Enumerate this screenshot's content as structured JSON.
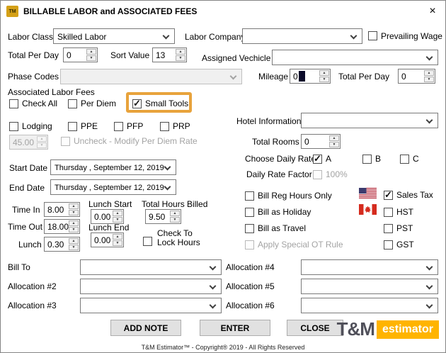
{
  "window": {
    "title": "BILLABLE LABOR and ASSOCIATED FEES",
    "icon": "TM",
    "close": "×"
  },
  "labor": {
    "labor_class_label": "Labor Class",
    "labor_class_value": "Skilled Labor",
    "labor_company_label": "Labor Company",
    "labor_company_value": "",
    "prevailing_wage_label": "Prevailing Wage",
    "prevailing_wage_checked": false,
    "total_per_day_label": "Total Per Day",
    "total_per_day_value": "0",
    "sort_value_label": "Sort Value",
    "sort_value_value": "13",
    "assigned_vehicle_label": "Assigned Vechicle",
    "assigned_vehicle_value": "",
    "phase_codes_label": "Phase Codes",
    "phase_codes_value": "",
    "phase_codes_enabled": false,
    "mileage_label": "Mileage",
    "mileage_value": "0",
    "total_per_day2_label": "Total Per Day",
    "total_per_day2_value": "0"
  },
  "fees": {
    "section_label": "Associated Labor Fees",
    "check_all_label": "Check All",
    "check_all_checked": false,
    "per_diem_label": "Per Diem",
    "per_diem_checked": false,
    "small_tools_label": "Small Tools",
    "small_tools_checked": true,
    "lodging_label": "Lodging",
    "lodging_checked": false,
    "ppe_label": "PPE",
    "pfp_label": "PFP",
    "prp_label": "PRP",
    "per_diem_rate_value": "45.00",
    "per_diem_rate_enabled": false,
    "uncheck_modify_label": "Uncheck - Modify Per Diem Rate"
  },
  "hotel": {
    "hotel_information_label": "Hotel Information",
    "hotel_information_value": "",
    "total_rooms_label": "Total Rooms",
    "total_rooms_value": "0",
    "choose_daily_rate_label": "Choose Daily Rate",
    "rate_a_label": "A",
    "rate_a_checked": true,
    "rate_b_label": "B",
    "rate_b_checked": false,
    "rate_c_label": "C",
    "rate_c_checked": false,
    "daily_rate_factor_label": "Daily Rate Factor",
    "daily_rate_factor_value": "100%"
  },
  "dates": {
    "start_date_label": "Start Date",
    "start_date_value": "Thursday , September 12, 2019",
    "end_date_label": "End Date",
    "end_date_value": "Thursday , September 12, 2019"
  },
  "hours": {
    "time_in_label": "Time In",
    "time_in_value": "8.00",
    "time_out_label": "Time Out",
    "time_out_value": "18.00",
    "lunch_label": "Lunch",
    "lunch_value": "0.30",
    "lunch_start_label": "Lunch Start",
    "lunch_start_value": "0.00",
    "lunch_end_label": "Lunch End",
    "lunch_end_value": "0.00",
    "total_hours_billed_label": "Total Hours Billed",
    "total_hours_billed_value": "9.50",
    "lock_hours_label": "Check To Lock Hours"
  },
  "billing_options": {
    "bill_reg_hours_label": "Bill Reg Hours Only",
    "bill_as_holiday_label": "Bill as Holiday",
    "bill_as_travel_label": "Bill as Travel",
    "apply_special_ot_label": "Apply Special OT Rule",
    "sales_tax_label": "Sales Tax",
    "sales_tax_checked": true,
    "hst_label": "HST",
    "pst_label": "PST",
    "gst_label": "GST"
  },
  "allocations": {
    "bill_to_label": "Bill To",
    "bill_to_value": "",
    "allocation2_label": "Allocation #2",
    "allocation2_value": "",
    "allocation3_label": "Allocation #3",
    "allocation3_value": "",
    "allocation4_label": "Allocation #4",
    "allocation4_value": "",
    "allocation5_label": "Allocation #5",
    "allocation5_value": "",
    "allocation6_label": "Allocation #6",
    "allocation6_value": ""
  },
  "buttons": {
    "add_note": "ADD NOTE",
    "enter": "ENTER",
    "close": "CLOSE"
  },
  "footer": {
    "copyright": "T&M Estimator™ - Copyright® 2019 - All Rights Reserved",
    "logo_tm": "T&M",
    "logo_estimator": "estimator"
  },
  "colors": {
    "highlight_box": "#e8a33c",
    "logo_gold": "#ffb400",
    "us_flag_blue": "#3c3b6e",
    "us_flag_red": "#b22234",
    "canada_red": "#d52b1e"
  }
}
